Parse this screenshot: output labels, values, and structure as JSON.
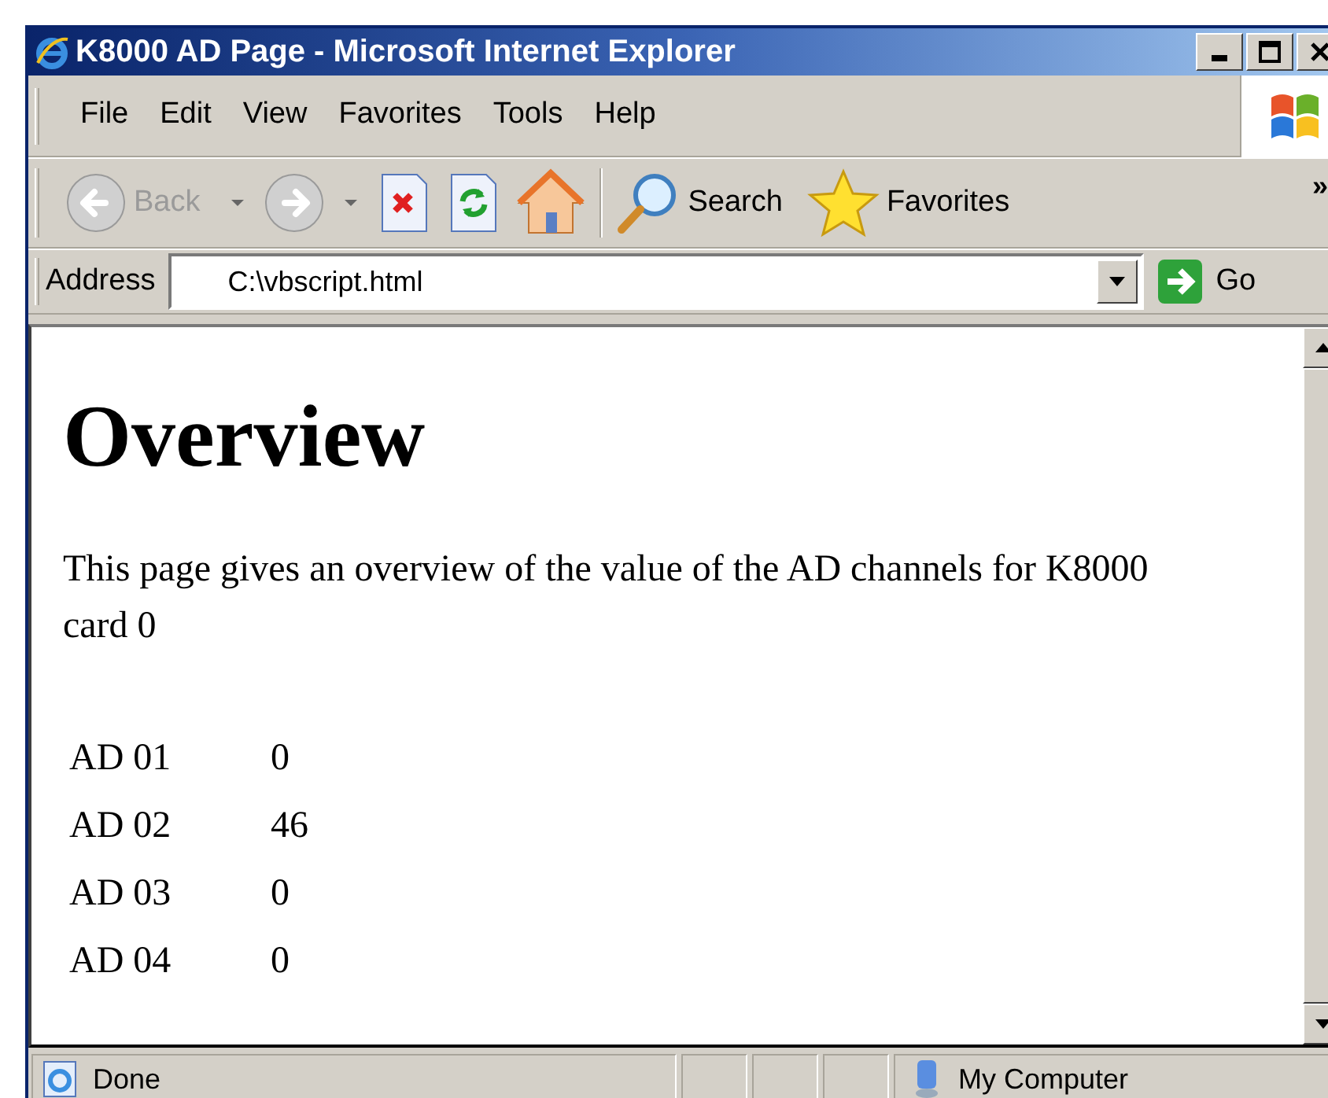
{
  "window": {
    "title": "K8000 AD Page - Microsoft Internet Explorer"
  },
  "menu": [
    {
      "label": "File"
    },
    {
      "label": "Edit"
    },
    {
      "label": "View"
    },
    {
      "label": "Favorites"
    },
    {
      "label": "Tools"
    },
    {
      "label": "Help"
    }
  ],
  "toolbar": [
    {
      "kind": "back",
      "label": "Back",
      "disabled": true
    },
    {
      "kind": "forward",
      "disabled": true
    },
    {
      "kind": "stop"
    },
    {
      "kind": "refresh"
    },
    {
      "kind": "home"
    },
    {
      "kind": "search",
      "label": "Search"
    },
    {
      "kind": "favorites",
      "label": "Favorites"
    }
  ],
  "toolbar_overflow": "»",
  "address": {
    "label": "Address",
    "value": "C:\\vbscript.html",
    "go": "Go"
  },
  "page": {
    "heading": "Overview",
    "intro": "This page gives an overview of the value of the AD channels for K8000 card 0",
    "rows": [
      {
        "channel": "AD 01",
        "value": "0"
      },
      {
        "channel": "AD 02",
        "value": "46"
      },
      {
        "channel": "AD 03",
        "value": "0"
      },
      {
        "channel": "AD 04",
        "value": "0"
      }
    ]
  },
  "status_bar": {
    "text": "Done",
    "zone": "My Computer"
  }
}
